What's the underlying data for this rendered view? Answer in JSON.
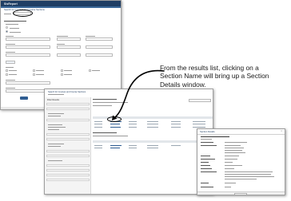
{
  "callout": {
    "line1": "From the results list, clicking on a",
    "line2": "Section Name will bring up a Section",
    "line3": "Details window."
  },
  "search_form": {
    "logo": "SisReport",
    "page_title": "Search for Courses and Course Sections"
  },
  "results": {
    "page_title": "Search for Courses and Course Sections",
    "filter_title": "Filter Results"
  },
  "details": {
    "title": "Section Details",
    "close_icon": "×"
  },
  "icons": {
    "arrow": "curved-arrow"
  },
  "colors": {
    "banner": "#1f3e64",
    "accent": "#2f5d92",
    "highlight": "#000000"
  }
}
